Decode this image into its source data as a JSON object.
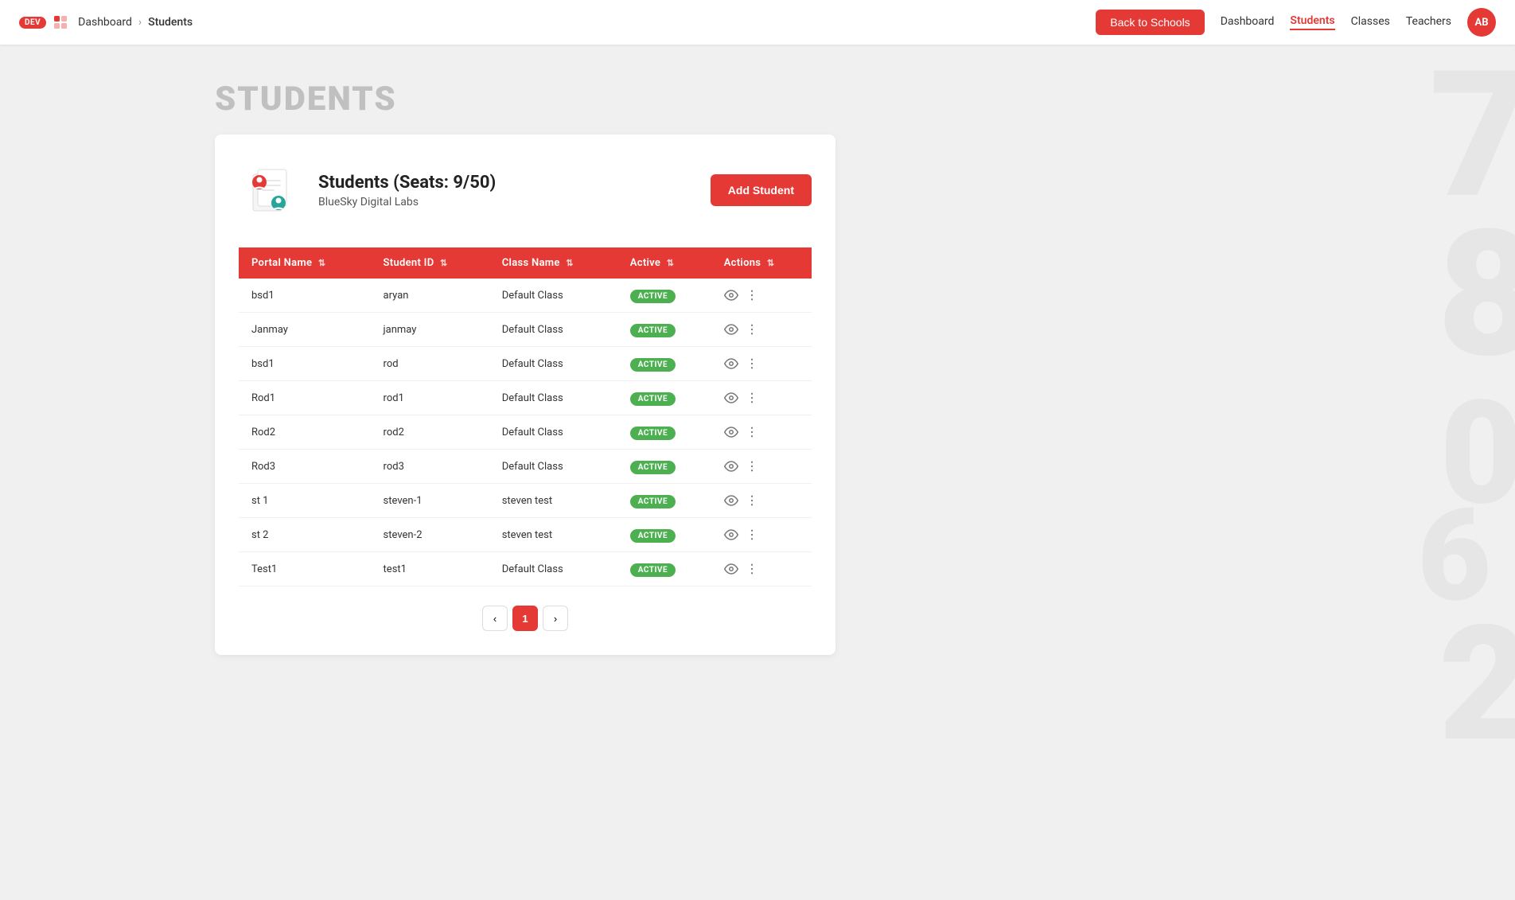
{
  "app": {
    "dev_badge": "DEV"
  },
  "navbar": {
    "back_to_schools": "Back to Schools",
    "dashboard": "Dashboard",
    "students": "Students",
    "classes": "Classes",
    "teachers": "Teachers",
    "avatar_initials": "AB"
  },
  "breadcrumb": {
    "home": "Dashboard",
    "current": "Students"
  },
  "page": {
    "title": "STUDENTS"
  },
  "student_summary": {
    "heading": "Students (Seats: 9/50)",
    "org": "BlueSky Digital Labs",
    "add_button": "Add Student"
  },
  "table": {
    "columns": [
      {
        "key": "portal_name",
        "label": "Portal Name"
      },
      {
        "key": "student_id",
        "label": "Student ID"
      },
      {
        "key": "class_name",
        "label": "Class Name"
      },
      {
        "key": "active",
        "label": "Active"
      },
      {
        "key": "actions",
        "label": "Actions"
      }
    ],
    "rows": [
      {
        "portal_name": "bsd1",
        "student_id": "aryan",
        "class_name": "Default Class",
        "active": "ACTIVE"
      },
      {
        "portal_name": "Janmay",
        "student_id": "janmay",
        "class_name": "Default Class",
        "active": "ACTIVE"
      },
      {
        "portal_name": "bsd1",
        "student_id": "rod",
        "class_name": "Default Class",
        "active": "ACTIVE"
      },
      {
        "portal_name": "Rod1",
        "student_id": "rod1",
        "class_name": "Default Class",
        "active": "ACTIVE"
      },
      {
        "portal_name": "Rod2",
        "student_id": "rod2",
        "class_name": "Default Class",
        "active": "ACTIVE"
      },
      {
        "portal_name": "Rod3",
        "student_id": "rod3",
        "class_name": "Default Class",
        "active": "ACTIVE"
      },
      {
        "portal_name": "st 1",
        "student_id": "steven-1",
        "class_name": "steven test",
        "active": "ACTIVE"
      },
      {
        "portal_name": "st 2",
        "student_id": "steven-2",
        "class_name": "steven test",
        "active": "ACTIVE"
      },
      {
        "portal_name": "Test1",
        "student_id": "test1",
        "class_name": "Default Class",
        "active": "ACTIVE"
      }
    ]
  },
  "pagination": {
    "current_page": "1"
  },
  "colors": {
    "primary": "#e53935",
    "active_badge": "#4caf50"
  }
}
